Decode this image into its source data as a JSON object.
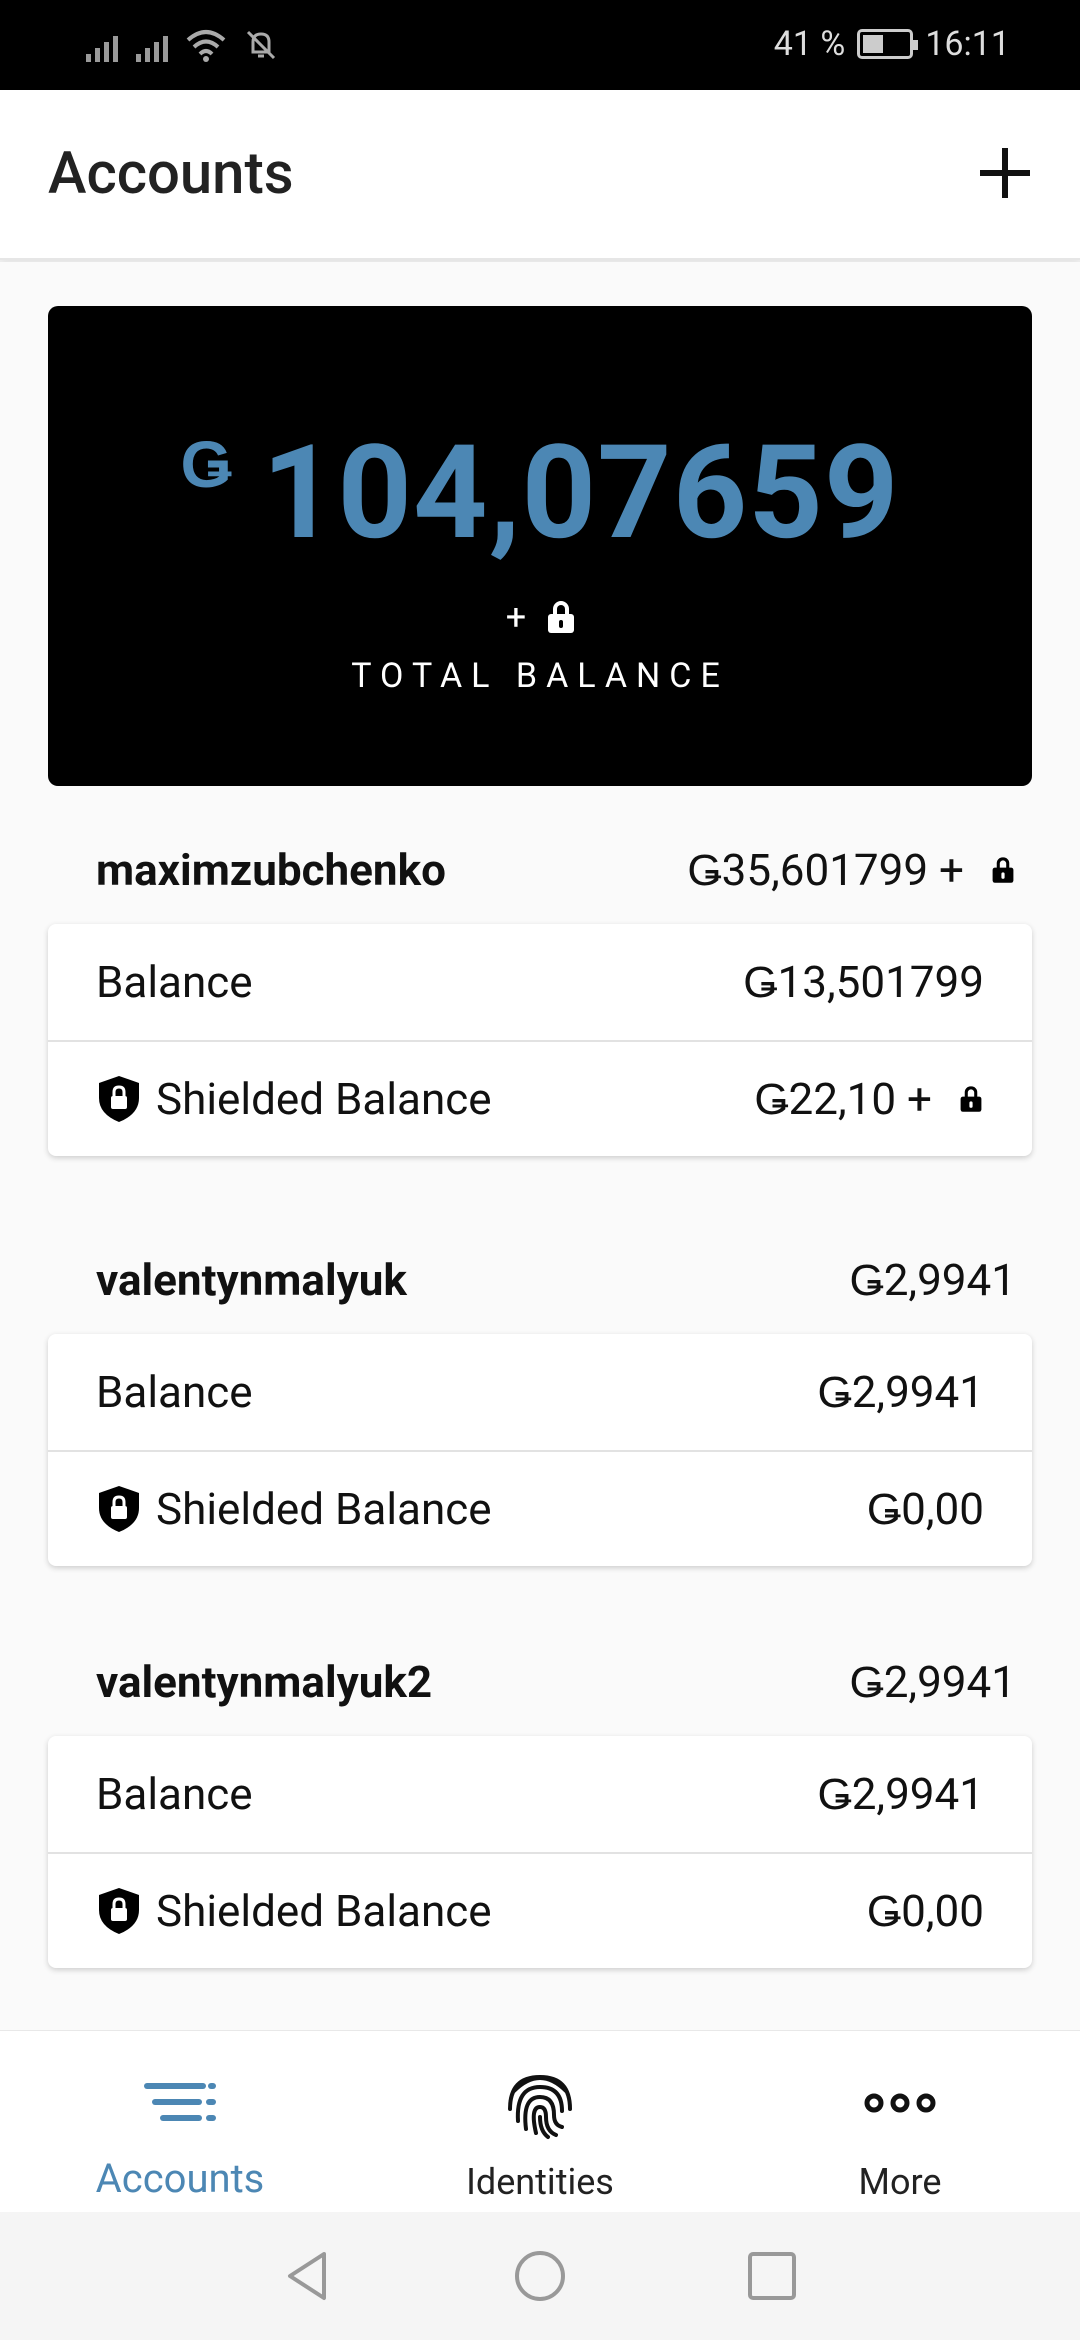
{
  "status_bar": {
    "battery_percent": "41 %",
    "time": "16:11"
  },
  "header": {
    "title": "Accounts",
    "add_icon": "plus-icon"
  },
  "total": {
    "currency": "Ǥ",
    "amount": "104,07659",
    "plus": "+",
    "label": "TOTAL BALANCE"
  },
  "accounts": [
    {
      "name": "maximzubchenko",
      "total": "Ǥ35,601799 +",
      "total_has_lock": true,
      "balance_label": "Balance",
      "balance": "Ǥ13,501799",
      "shielded_label": "Shielded Balance",
      "shielded": "Ǥ22,10 +",
      "shielded_has_lock": true
    },
    {
      "name": "valentynmalyuk",
      "total": "Ǥ2,9941",
      "total_has_lock": false,
      "balance_label": "Balance",
      "balance": "Ǥ2,9941",
      "shielded_label": "Shielded Balance",
      "shielded": "Ǥ0,00",
      "shielded_has_lock": false
    },
    {
      "name": "valentynmalyuk2",
      "total": "Ǥ2,9941",
      "total_has_lock": false,
      "balance_label": "Balance",
      "balance": "Ǥ2,9941",
      "shielded_label": "Shielded Balance",
      "shielded": "Ǥ0,00",
      "shielded_has_lock": false
    }
  ],
  "nav": {
    "items": [
      {
        "label": "Accounts",
        "icon": "accounts-list-icon",
        "active": true
      },
      {
        "label": "Identities",
        "icon": "fingerprint-icon",
        "active": false
      },
      {
        "label": "More",
        "icon": "more-dots-icon",
        "active": false
      }
    ]
  },
  "colors": {
    "accent": "#4c87b4",
    "card_bg": "#000000"
  }
}
